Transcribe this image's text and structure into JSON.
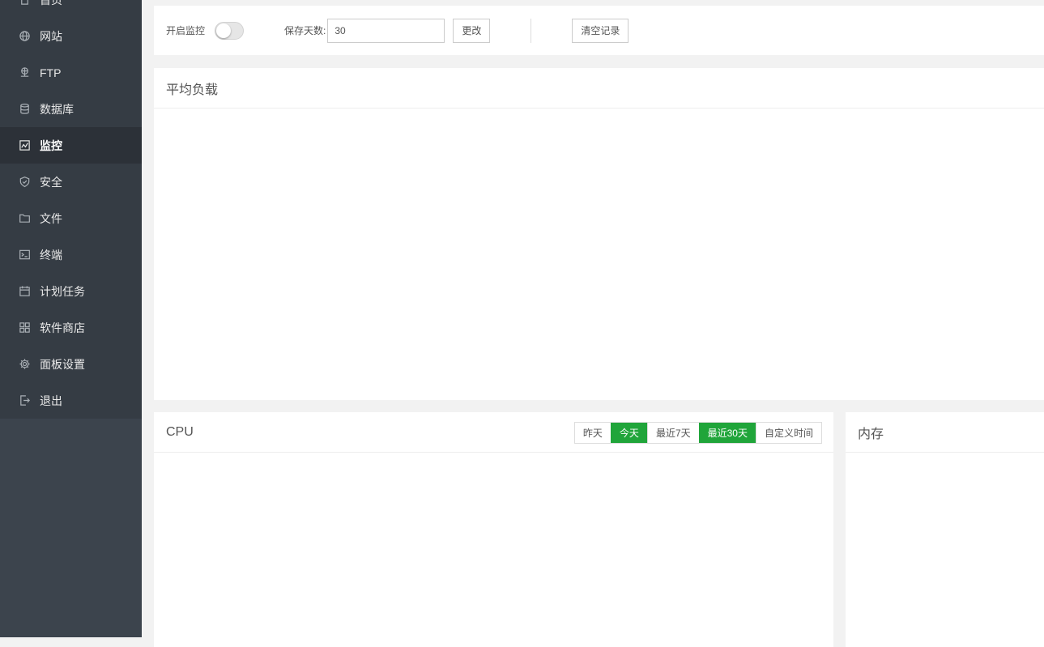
{
  "sidebar": {
    "items": [
      {
        "label": "首页",
        "icon": "home-icon",
        "active": false
      },
      {
        "label": "网站",
        "icon": "globe-icon",
        "active": false
      },
      {
        "label": "FTP",
        "icon": "ftp-icon",
        "active": false
      },
      {
        "label": "数据库",
        "icon": "database-icon",
        "active": false
      },
      {
        "label": "监控",
        "icon": "monitor-chart-icon",
        "active": true
      },
      {
        "label": "安全",
        "icon": "shield-icon",
        "active": false
      },
      {
        "label": "文件",
        "icon": "folder-icon",
        "active": false
      },
      {
        "label": "终端",
        "icon": "terminal-icon",
        "active": false
      },
      {
        "label": "计划任务",
        "icon": "calendar-icon",
        "active": false
      },
      {
        "label": "软件商店",
        "icon": "grid-apps-icon",
        "active": false
      },
      {
        "label": "面板设置",
        "icon": "gear-icon",
        "active": false
      },
      {
        "label": "退出",
        "icon": "logout-icon",
        "active": false
      }
    ]
  },
  "toolbar": {
    "monitor_label": "开启监控",
    "monitor_enabled": false,
    "days_label": "保存天数:",
    "days_value": "30",
    "change_label": "更改",
    "clear_label": "清空记录"
  },
  "panels": {
    "load_title": "平均负载",
    "cpu_title": "CPU",
    "mem_title": "内存"
  },
  "cpu_range": {
    "options": [
      "昨天",
      "今天",
      "最近7天",
      "最近30天",
      "自定义时间"
    ],
    "highlighted": [
      "今天",
      "最近30天"
    ]
  },
  "colors": {
    "accent": "#20a53a",
    "sidebar_bg": "#3c444d",
    "sidebar_active": "#2c3138"
  }
}
